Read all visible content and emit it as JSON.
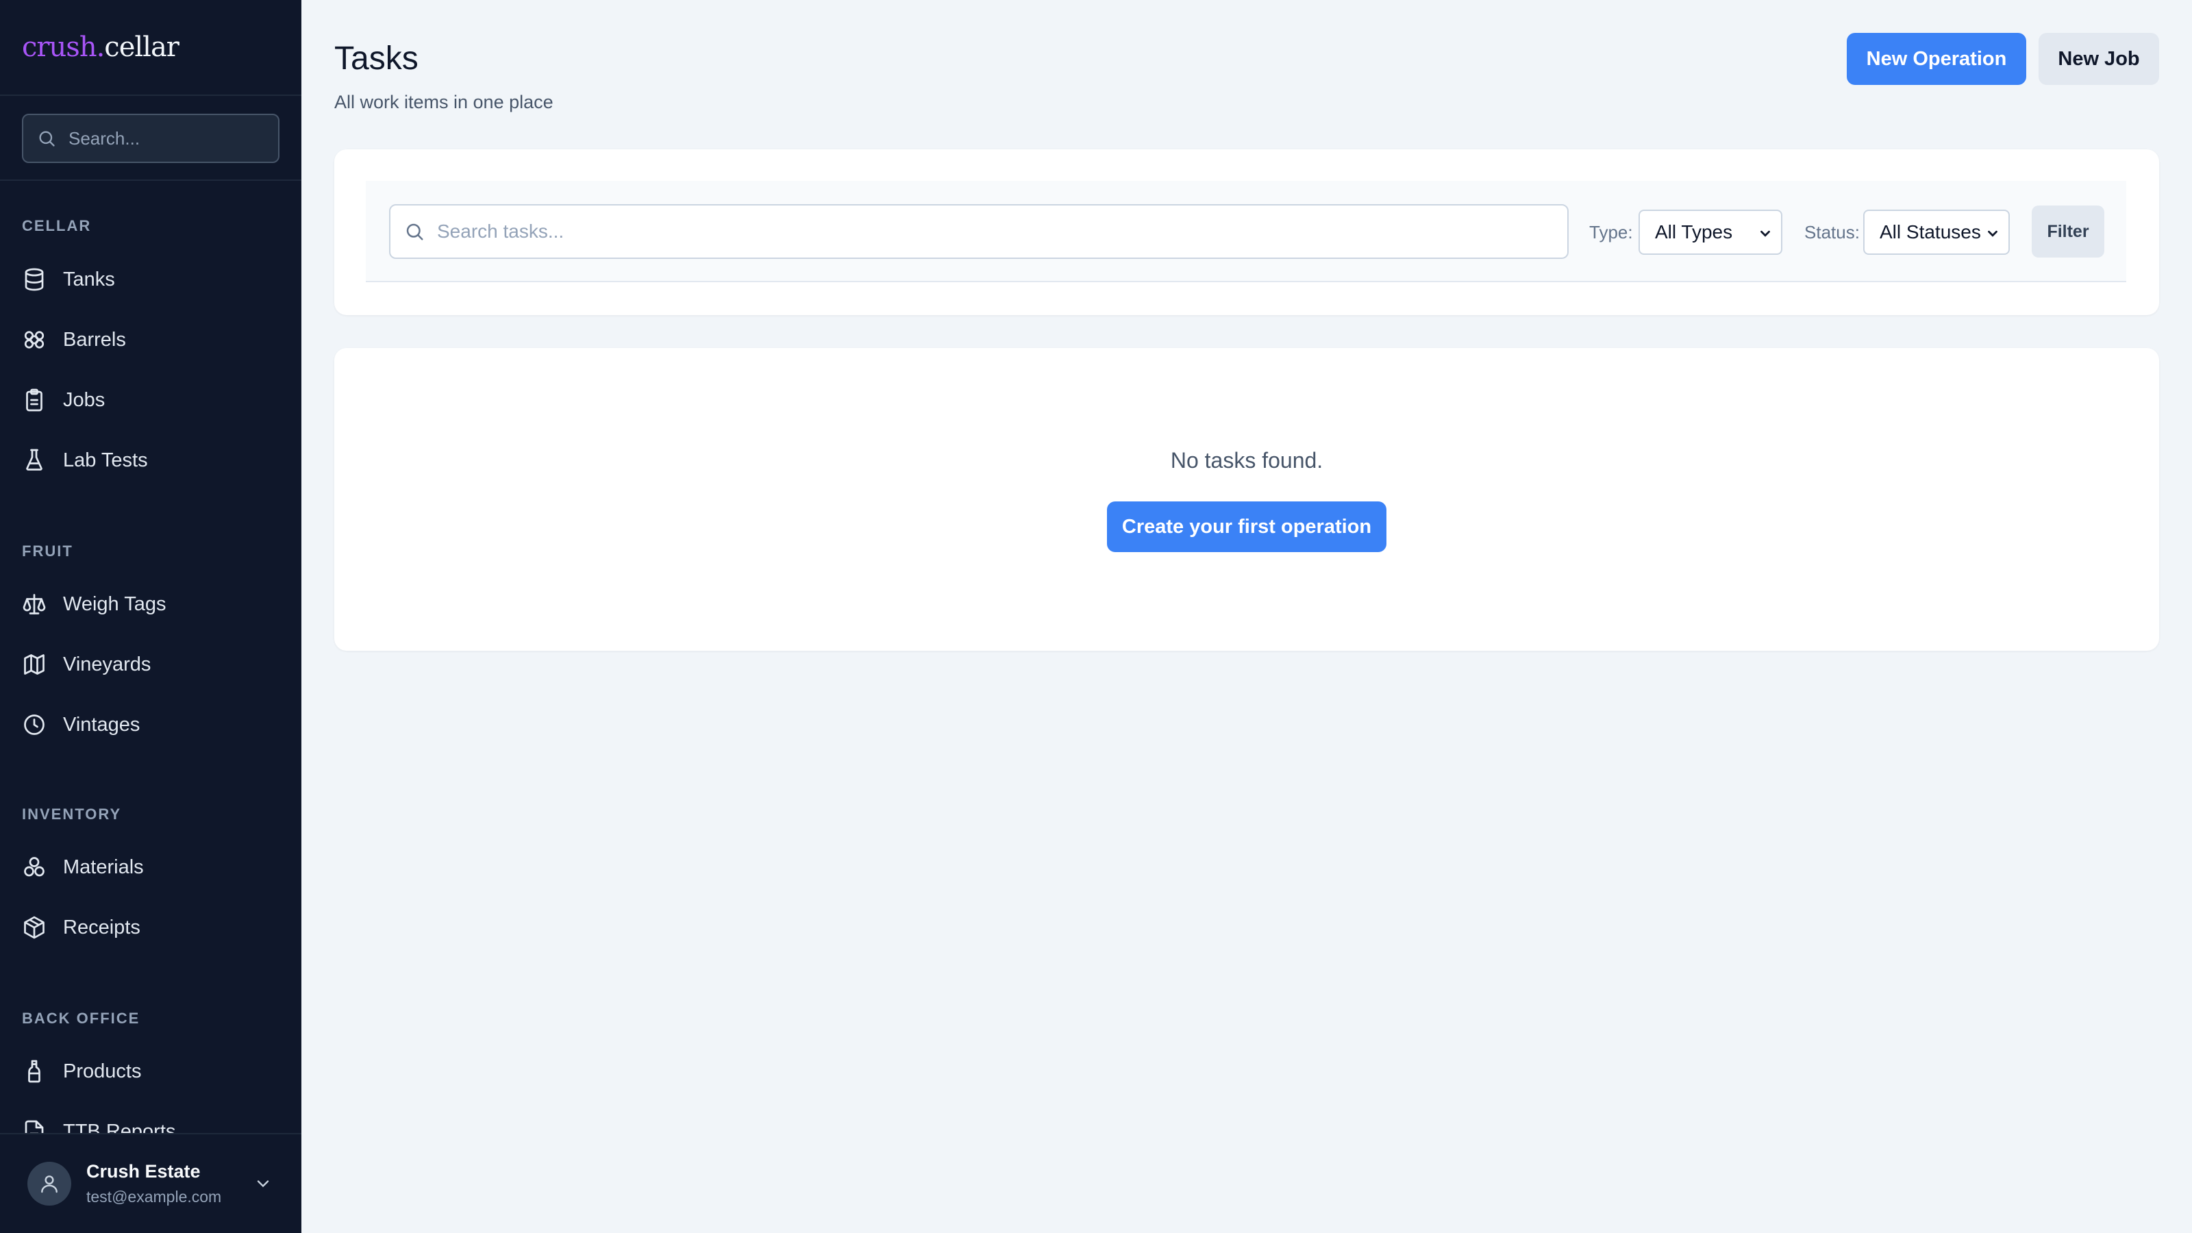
{
  "brand": {
    "part1": "crush.",
    "part2": "cellar"
  },
  "sidebar": {
    "search_placeholder": "Search...",
    "sections": [
      {
        "label": "CELLAR",
        "items": [
          {
            "label": "Tanks",
            "icon": "database-icon"
          },
          {
            "label": "Barrels",
            "icon": "barrels-icon"
          },
          {
            "label": "Jobs",
            "icon": "clipboard-icon"
          },
          {
            "label": "Lab Tests",
            "icon": "flask-icon"
          }
        ]
      },
      {
        "label": "FRUIT",
        "items": [
          {
            "label": "Weigh Tags",
            "icon": "scale-icon"
          },
          {
            "label": "Vineyards",
            "icon": "map-icon"
          },
          {
            "label": "Vintages",
            "icon": "clock-icon"
          }
        ]
      },
      {
        "label": "INVENTORY",
        "items": [
          {
            "label": "Materials",
            "icon": "shapes-icon"
          },
          {
            "label": "Receipts",
            "icon": "package-icon"
          }
        ]
      },
      {
        "label": "BACK OFFICE",
        "items": [
          {
            "label": "Products",
            "icon": "bottle-icon"
          },
          {
            "label": "TTB Reports",
            "icon": "file-report-icon"
          }
        ]
      }
    ],
    "user": {
      "name": "Crush Estate",
      "email": "test@example.com"
    }
  },
  "header": {
    "title": "Tasks",
    "subtitle": "All work items in one place",
    "new_operation_label": "New Operation",
    "new_job_label": "New Job"
  },
  "filters": {
    "search_placeholder": "Search tasks...",
    "type_label": "Type:",
    "type_value": "All Types",
    "status_label": "Status:",
    "status_value": "All Statuses",
    "filter_button": "Filter"
  },
  "empty_state": {
    "message": "No tasks found.",
    "cta_label": "Create your first operation"
  },
  "colors": {
    "sidebar_bg": "#0f172a",
    "primary": "#3b82f6",
    "brand_accent": "#a855f7",
    "page_bg": "#f1f5f9"
  }
}
